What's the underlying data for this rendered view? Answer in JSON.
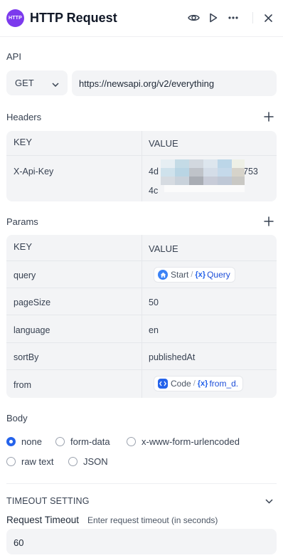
{
  "header": {
    "logo_text": "HTTP",
    "title": "HTTP Request",
    "icons": [
      "eye-icon",
      "play-icon",
      "more-icon",
      "close-icon"
    ]
  },
  "api": {
    "label": "API",
    "method": "GET",
    "url": "https://newsapi.org/v2/everything"
  },
  "headers": {
    "label": "Headers",
    "columns": [
      "KEY",
      "VALUE"
    ],
    "rows": [
      {
        "key": "X-Api-Key",
        "value_prefix": "4d",
        "value_suffix": "753",
        "value_line2": "4c"
      }
    ]
  },
  "params": {
    "label": "Params",
    "columns": [
      "KEY",
      "VALUE"
    ],
    "rows": [
      {
        "key": "query",
        "type": "var",
        "source": "Start",
        "variable": "Query"
      },
      {
        "key": "pageSize",
        "type": "text",
        "value": "50"
      },
      {
        "key": "language",
        "type": "text",
        "value": "en"
      },
      {
        "key": "sortBy",
        "type": "text",
        "value": "publishedAt"
      },
      {
        "key": "from",
        "type": "var",
        "source": "Code",
        "variable": "from_d."
      }
    ]
  },
  "body": {
    "label": "Body",
    "options": [
      "none",
      "form-data",
      "x-www-form-urlencoded",
      "raw text",
      "JSON"
    ],
    "selected": "none"
  },
  "timeout": {
    "section_label": "TIMEOUT SETTING",
    "field_label": "Request Timeout",
    "hint": "Enter request timeout (in seconds)",
    "value": "60"
  },
  "colors": {
    "accent": "#2563eb",
    "logo": "#7c3aed",
    "field_bg": "#f3f4f6"
  }
}
